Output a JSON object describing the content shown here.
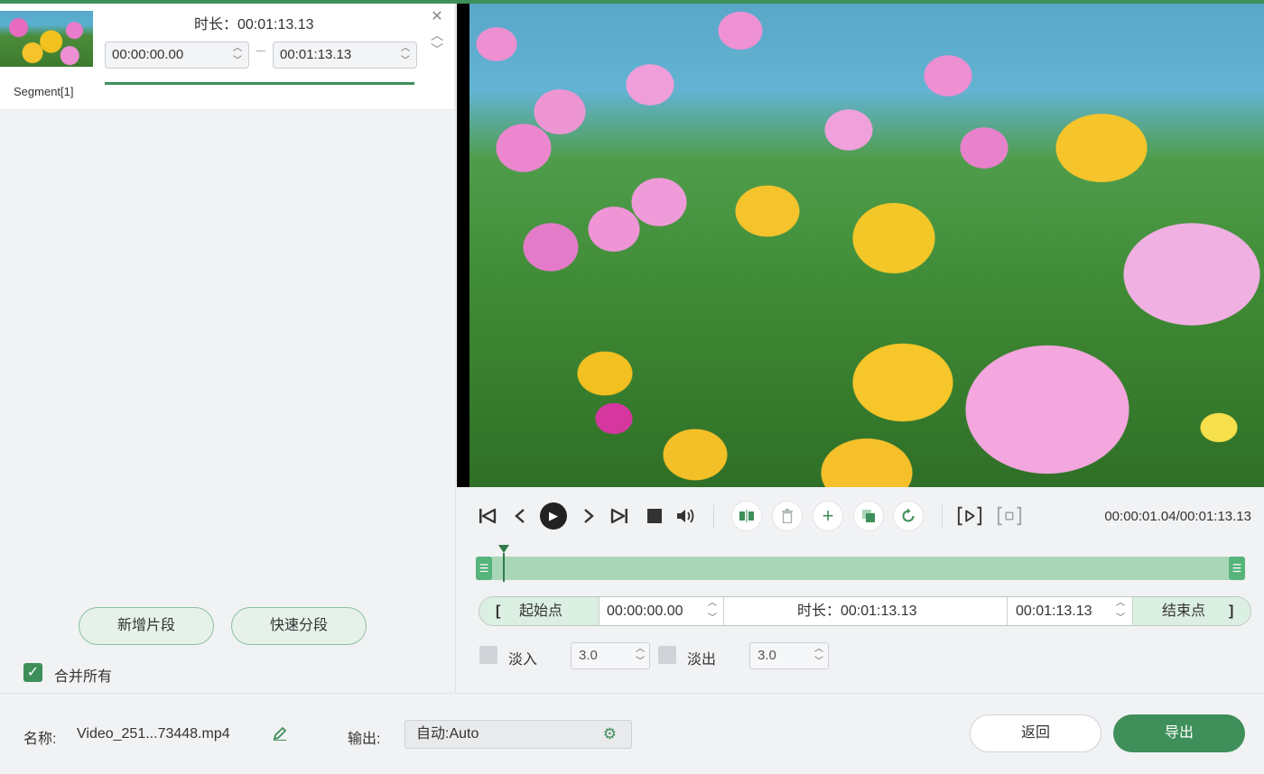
{
  "segment": {
    "label": "Segment[1]",
    "duration_label": "时长：00:01:13.13",
    "start_time": "00:00:00.00",
    "end_time": "00:01:13.13"
  },
  "left_actions": {
    "add_segment": "新增片段",
    "quick_split": "快速分段",
    "merge_all": "合并所有",
    "merge_checked": true
  },
  "player": {
    "time_readout": "00:00:01.04/00:01:13.13",
    "playhead_fraction": 0.014
  },
  "range": {
    "start_point_label": "起始点",
    "start_time": "00:00:00.00",
    "duration_label": "时长：00:01:13.13",
    "end_time": "00:01:13.13",
    "end_point_label": "结束点"
  },
  "fade": {
    "fade_in_label": "淡入",
    "fade_in_value": "3.0",
    "fade_out_label": "淡出",
    "fade_out_value": "3.0"
  },
  "footer": {
    "name_label": "名称:",
    "file_name": "Video_251...73448.mp4",
    "output_label": "输出:",
    "output_value": "自动:Auto",
    "back_label": "返回",
    "export_label": "导出"
  },
  "colors": {
    "accent": "#3f8f5a",
    "track": "#a9d6b7"
  }
}
